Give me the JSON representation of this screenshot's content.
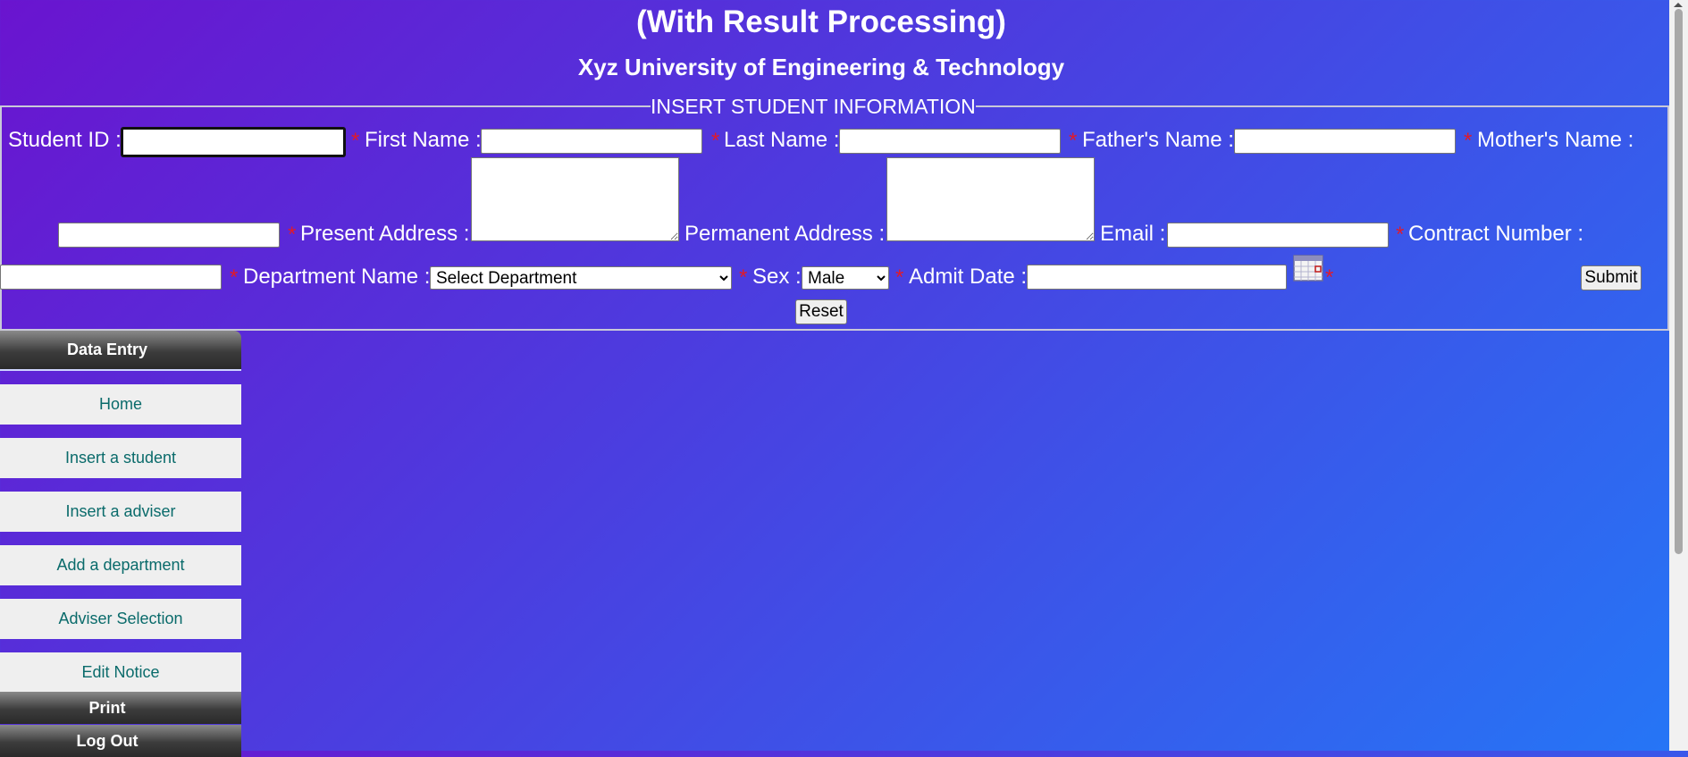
{
  "header": {
    "title": "(With Result Processing)",
    "subtitle": "Xyz University of Engineering & Technology"
  },
  "form": {
    "legend": "INSERT STUDENT INFORMATION",
    "required_mark": "*",
    "student_id_label": "Student ID :",
    "first_name_label": "First Name :",
    "last_name_label": "Last Name :",
    "fathers_name_label": "Father's Name :",
    "mothers_name_label": "Mother's Name :",
    "present_address_label": "Present Address :",
    "permanent_address_label": "Permanent Address :",
    "email_label": "Email :",
    "contract_number_label": "Contract Number :",
    "department_label": "Department Name :",
    "department_selected": "Select Department",
    "sex_label": "Sex :",
    "sex_selected": "Male",
    "admit_date_label": "Admit Date :",
    "submit_label": "Submit",
    "reset_label": "Reset"
  },
  "sidebar": {
    "section_data_entry": "Data Entry",
    "items": [
      {
        "label": "Home"
      },
      {
        "label": "Insert a student"
      },
      {
        "label": "Insert a adviser"
      },
      {
        "label": "Add a department"
      },
      {
        "label": "Adviser Selection"
      },
      {
        "label": "Edit Notice"
      }
    ],
    "section_print": "Print",
    "section_logout": "Log Out"
  },
  "colors": {
    "gradient_start": "#6a14cf",
    "gradient_end": "#2576f6",
    "required": "#e01a2a",
    "sidebar_link": "#0a6b6b"
  },
  "icons": {
    "calendar": "calendar-icon"
  }
}
